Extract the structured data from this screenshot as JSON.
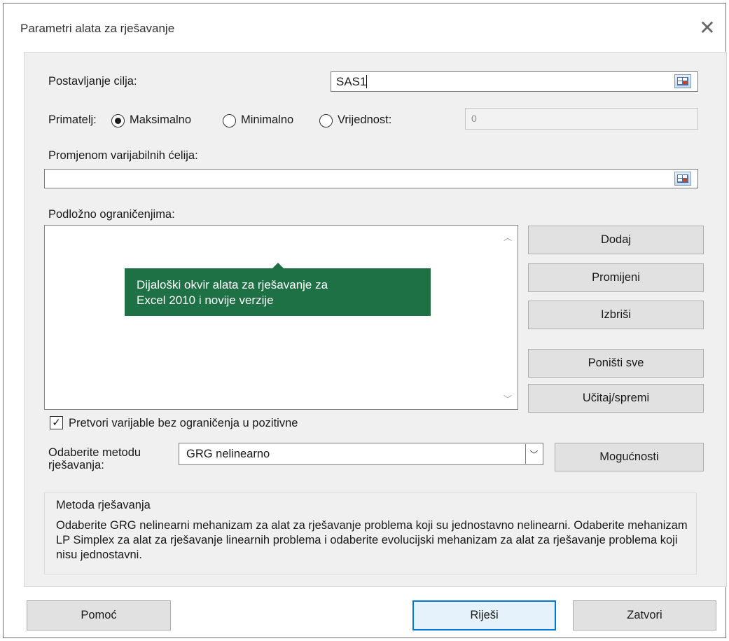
{
  "window": {
    "title": "Parametri alata za rješavanje",
    "close_glyph": "✕"
  },
  "objective": {
    "label": "Postavljanje cilja:",
    "value": "SAS1"
  },
  "to": {
    "label": "Primatelj:",
    "options": [
      "Maksimalno",
      "Minimalno",
      "Vrijednost:"
    ],
    "selected": "Maksimalno",
    "value_of": "0"
  },
  "changing_cells": {
    "label": "Promjenom varijabilnih ćelija:",
    "value": ""
  },
  "constraints": {
    "label": "Podložno ograničenjima:",
    "items": [],
    "buttons": {
      "add": "Dodaj",
      "change": "Promijeni",
      "delete": "Izbriši",
      "reset_all": "Poništi sve",
      "load_save": "Učitaj/spremi"
    }
  },
  "tooltip": {
    "line1": "Dijaloški okvir alata za rješavanje za",
    "line2": "Excel 2010 i novije verzije"
  },
  "nonneg": {
    "label": "Pretvori varijable bez ograničenja u pozitivne",
    "checked": true
  },
  "method": {
    "label_line1": "Odaberite metodu",
    "label_line2": "rješavanja:",
    "selected": "GRG nelinearno",
    "options_button": "Mogućnosti"
  },
  "method_group": {
    "title": "Metoda rješavanja",
    "description": "Odaberite GRG nelinearni mehanizam za alat za rješavanje problema koji su jednostavno nelinearni. Odaberite mehanizam LP Simplex za alat za rješavanje linearnih problema i odaberite evolucijski mehanizam za alat za rješavanje problema koji nisu jednostavni."
  },
  "footer": {
    "help": "Pomoć",
    "solve": "Riješi",
    "close": "Zatvori"
  },
  "icons": {
    "close": "close-icon",
    "range_ref": "range-select-icon",
    "scroll_up": "chevron-up-icon",
    "scroll_down": "chevron-down-icon",
    "dropdown": "chevron-down-icon",
    "check": "checkmark-icon"
  },
  "colors": {
    "tooltip_bg": "#1e7145",
    "default_button_border": "#0078d7",
    "panel_bg": "#f0f0f0"
  }
}
